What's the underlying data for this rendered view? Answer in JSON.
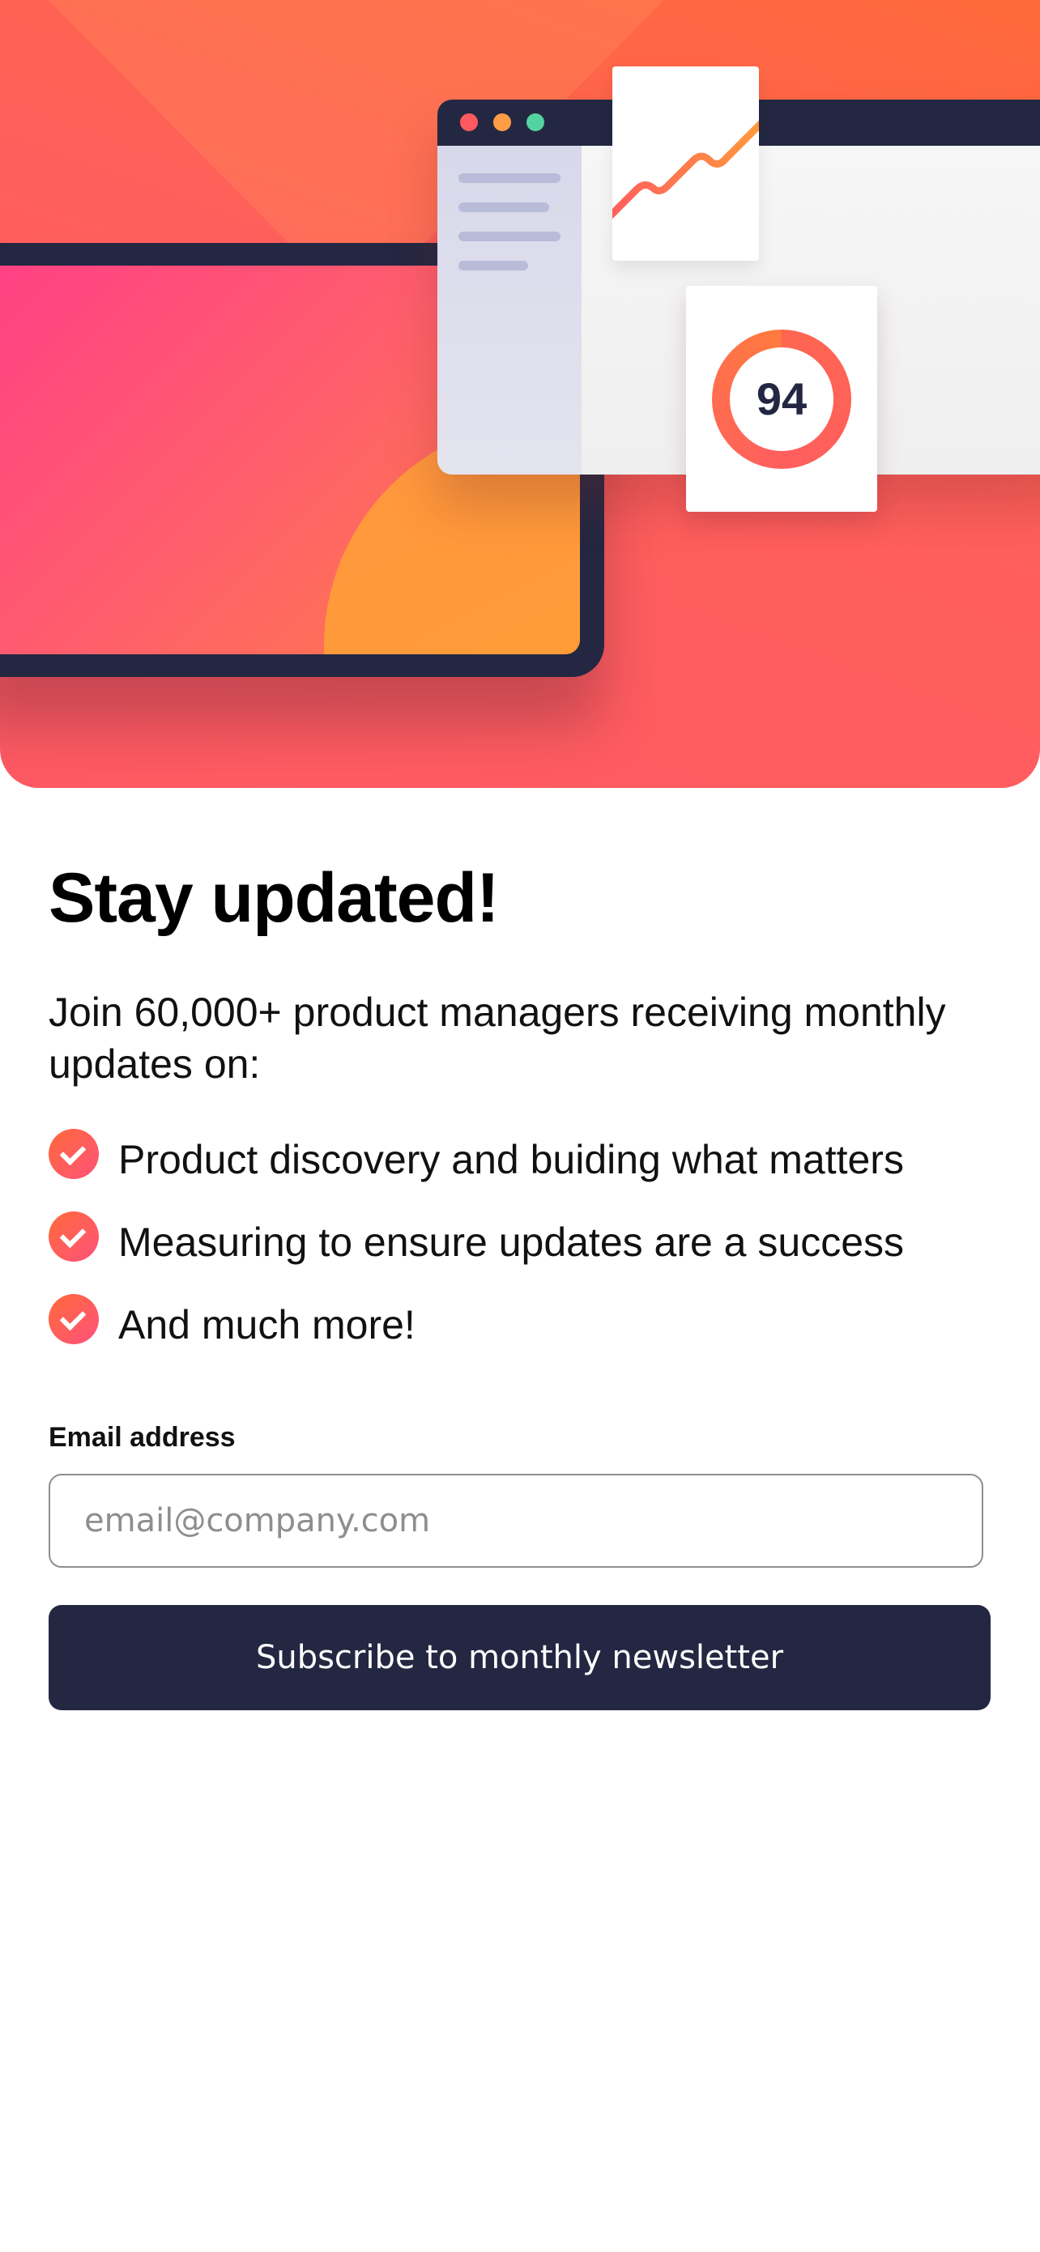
{
  "hero": {
    "score": "94",
    "colors": {
      "gradient_start": "#ff3f86",
      "gradient_end": "#ff6a3a",
      "navy": "#242742",
      "dot_red": "#ff5a5f",
      "dot_orange": "#ff9d47",
      "dot_green": "#54d3a0"
    }
  },
  "content": {
    "title": "Stay updated!",
    "lead": "Join 60,000+ product managers receiving monthly updates on:",
    "features": [
      {
        "text": "Product discovery and buiding what matters",
        "icon": "check-icon"
      },
      {
        "text": "Measuring to ensure updates are a success",
        "icon": "check-icon"
      },
      {
        "text": "And much more!",
        "icon": "check-icon"
      }
    ]
  },
  "form": {
    "email_label": "Email address",
    "email_placeholder": "email@company.com",
    "email_value": "",
    "submit_label": "Subscribe to monthly newsletter"
  },
  "theme": {
    "accent": "#ff6155",
    "button_bg": "#242742",
    "text": "#111111"
  }
}
